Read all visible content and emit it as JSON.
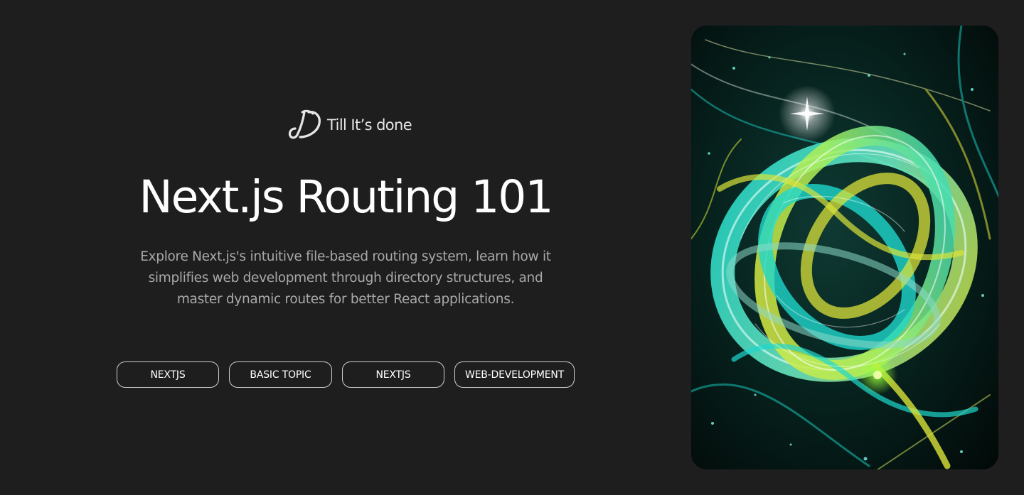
{
  "brand": {
    "name": "Till It’s done",
    "icon": "brand-monogram-icon"
  },
  "post": {
    "title": "Next.js Routing 101",
    "description": "Explore Next.js's intuitive file-based routing system, learn how it simplifies web development through directory structures, and master dynamic routes for better React applications.",
    "tags": [
      "NEXTJS",
      "BASIC TOPIC",
      "NEXTJS",
      "WEB-DEVELOPMENT"
    ]
  },
  "hero": {
    "subject": "abstract glass swirl artwork"
  },
  "colors": {
    "background": "#1e1e1e",
    "text": "#ffffff",
    "muted_text": "#a9a9a9",
    "tag_border": "#cfcfcf",
    "accent_teal": "#16c9c0",
    "accent_yellow": "#d9e23a"
  }
}
